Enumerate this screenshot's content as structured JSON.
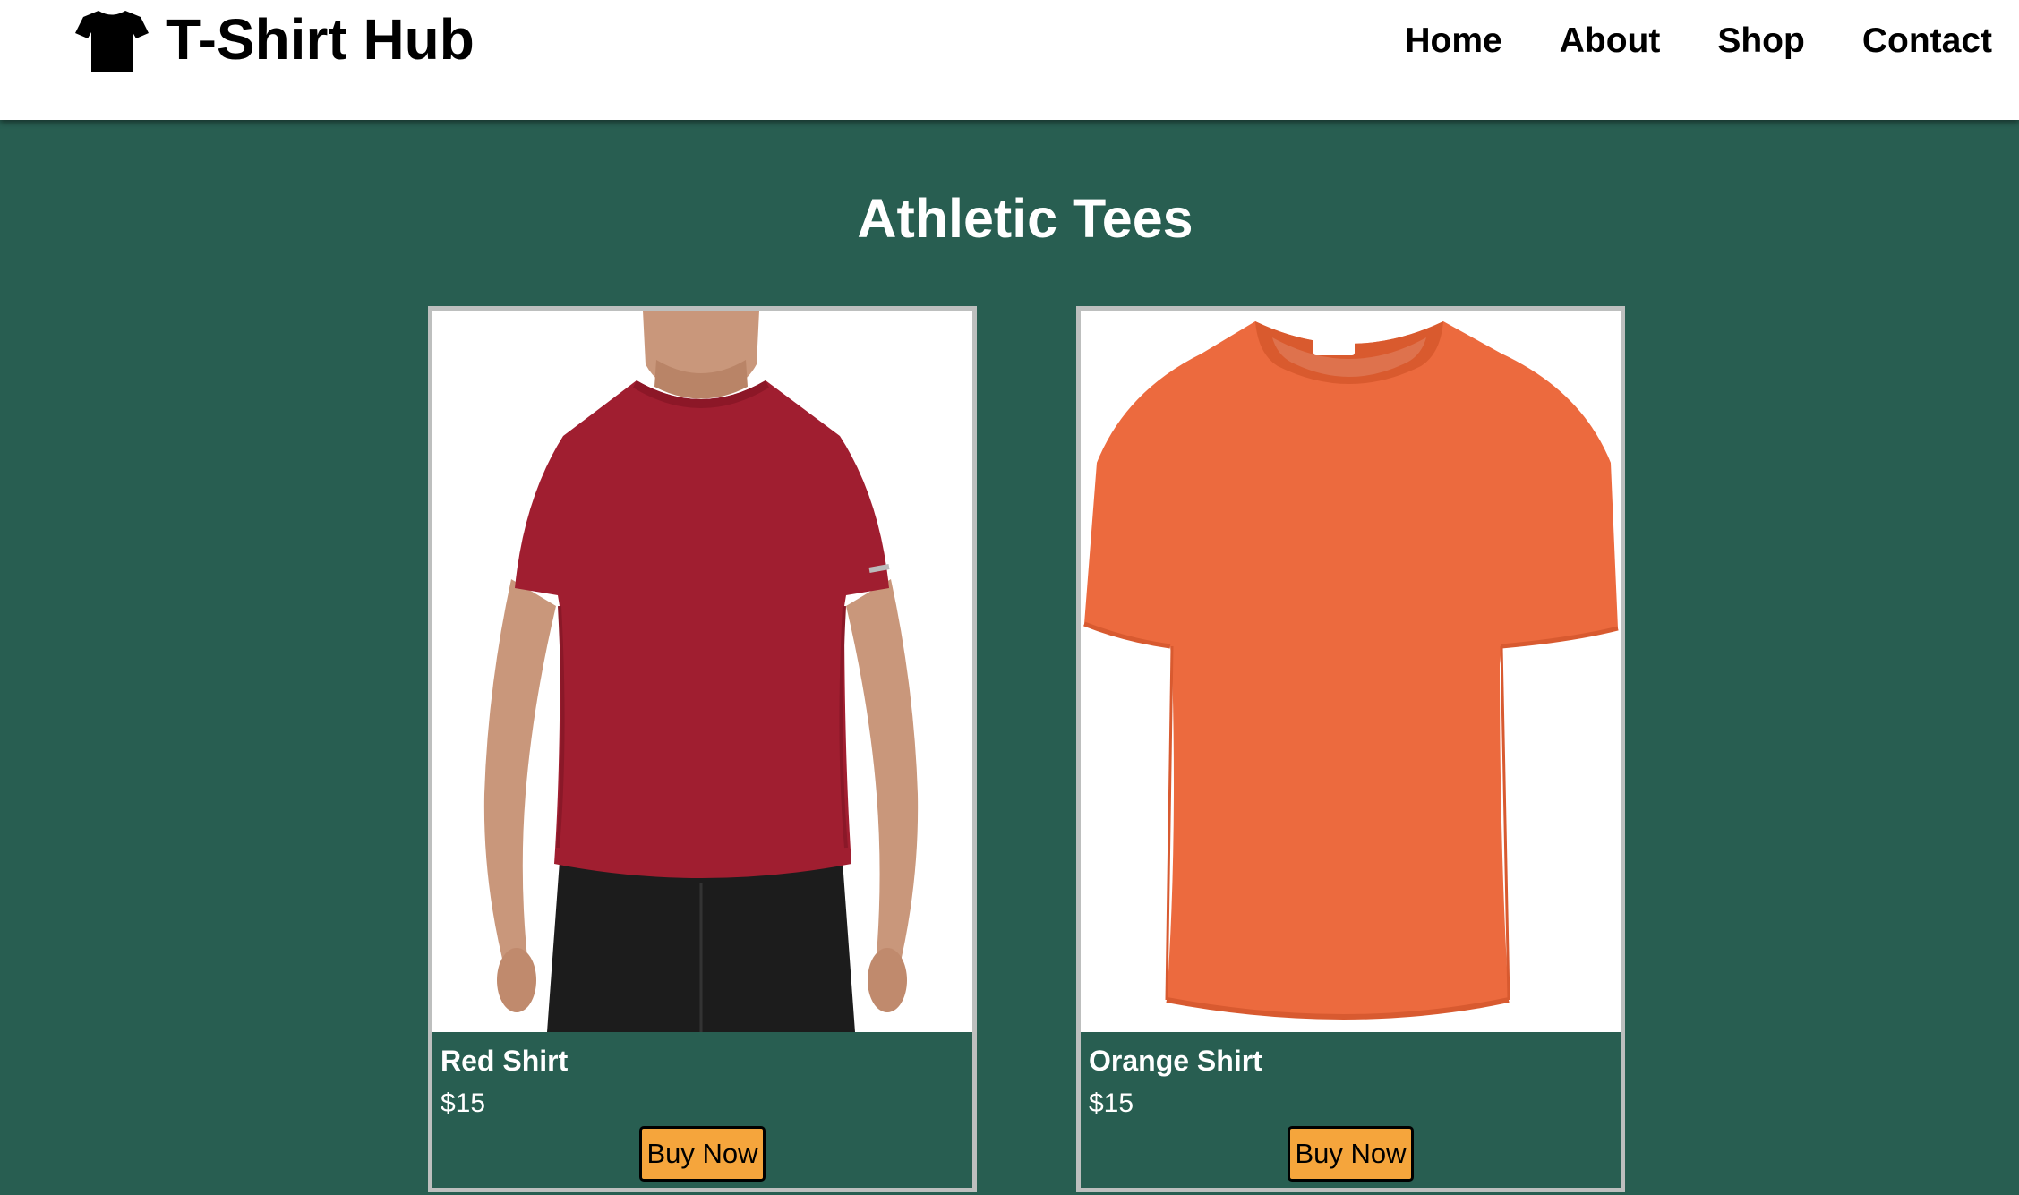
{
  "header": {
    "logo_icon": "t-shirt-icon",
    "brand": "T-Shirt Hub",
    "nav": [
      {
        "label": "Home"
      },
      {
        "label": "About"
      },
      {
        "label": "Shop"
      },
      {
        "label": "Contact"
      }
    ]
  },
  "main": {
    "title": "Athletic Tees",
    "products": [
      {
        "name": "Red Shirt",
        "price": "$15",
        "button": "Buy Now",
        "color": "#a01e30"
      },
      {
        "name": "Orange Shirt",
        "price": "$15",
        "button": "Buy Now",
        "color": "#ec6a3e"
      }
    ]
  },
  "colors": {
    "background": "#285e51",
    "header_bg": "#ffffff",
    "button_bg": "#f5a53c",
    "card_border": "#bdbfbe"
  }
}
